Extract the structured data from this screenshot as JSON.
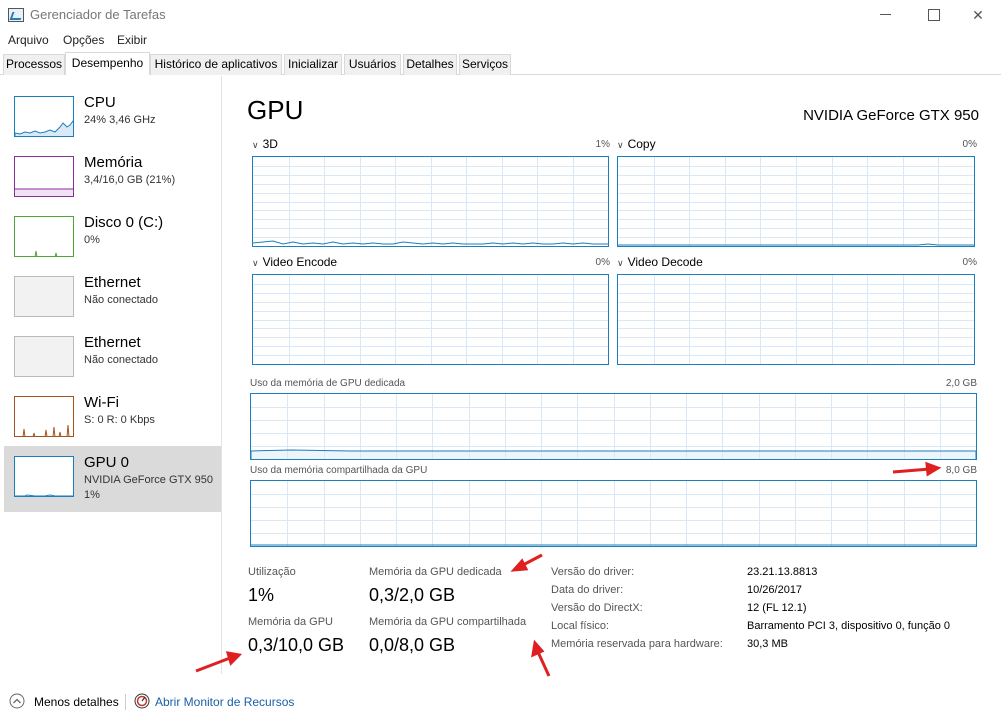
{
  "window": {
    "title": "Gerenciador de Tarefas",
    "minimize_icon": "minimize-icon",
    "maximize_icon": "maximize-icon",
    "close_glyph": "✕"
  },
  "menu": [
    "Arquivo",
    "Opções",
    "Exibir"
  ],
  "tabs": [
    "Processos",
    "Desempenho",
    "Histórico de aplicativos",
    "Inicializar",
    "Usuários",
    "Detalhes",
    "Serviços"
  ],
  "active_tab": "Desempenho",
  "sidebar": {
    "items": [
      {
        "name": "CPU",
        "sub": "24%  3,46 GHz",
        "sub2": "",
        "color": "#1a7fbf"
      },
      {
        "name": "Memória",
        "sub": "3,4/16,0 GB (21%)",
        "sub2": "",
        "color": "#8b2c9b"
      },
      {
        "name": "Disco 0 (C:)",
        "sub": "0%",
        "sub2": "",
        "color": "#4da636"
      },
      {
        "name": "Ethernet",
        "sub": "Não conectado",
        "sub2": "",
        "color": "#999999"
      },
      {
        "name": "Ethernet",
        "sub": "Não conectado",
        "sub2": "",
        "color": "#999999"
      },
      {
        "name": "Wi-Fi",
        "sub": "S: 0 R: 0 Kbps",
        "sub2": "",
        "color": "#a7531e"
      },
      {
        "name": "GPU 0",
        "sub": "NVIDIA GeForce GTX 950",
        "sub2": "1%",
        "color": "#1a7fbf"
      }
    ]
  },
  "main": {
    "title": "GPU",
    "model": "NVIDIA GeForce GTX 950",
    "graphs": [
      {
        "label": "3D",
        "pct": "1%"
      },
      {
        "label": "Copy",
        "pct": "0%"
      },
      {
        "label": "Video Encode",
        "pct": "0%"
      },
      {
        "label": "Video Decode",
        "pct": "0%"
      }
    ],
    "dedicated_mem": {
      "label": "Uso da memória de GPU dedicada",
      "max": "2,0 GB"
    },
    "shared_mem": {
      "label": "Uso da memória compartilhada da GPU",
      "max": "8,0 GB"
    },
    "stats": {
      "util_label": "Utilização",
      "util_value": "1%",
      "ded_label": "Memória da GPU dedicada",
      "ded_value": "0,3/2,0 GB",
      "gpu_mem_label": "Memória da GPU",
      "gpu_mem_value": "0,3/10,0 GB",
      "shared_label": "Memória da GPU compartilhada",
      "shared_value": "0,0/8,0 GB"
    },
    "info": [
      {
        "label": "Versão do driver:",
        "value": "23.21.13.8813"
      },
      {
        "label": "Data do driver:",
        "value": "10/26/2017"
      },
      {
        "label": "Versão do DirectX:",
        "value": "12 (FL 12.1)"
      },
      {
        "label": "Local físico:",
        "value": "Barramento PCI 3, dispositivo 0, função 0"
      },
      {
        "label": "Memória reservada para hardware:",
        "value": "30,3 MB"
      }
    ]
  },
  "footer": {
    "less_details": "Menos detalhes",
    "resource_monitor": "Abrir Monitor de Recursos"
  },
  "colors": {
    "accent": "#1a7fbf",
    "annotation": "#e02020",
    "selected_bg": "#dadada"
  }
}
